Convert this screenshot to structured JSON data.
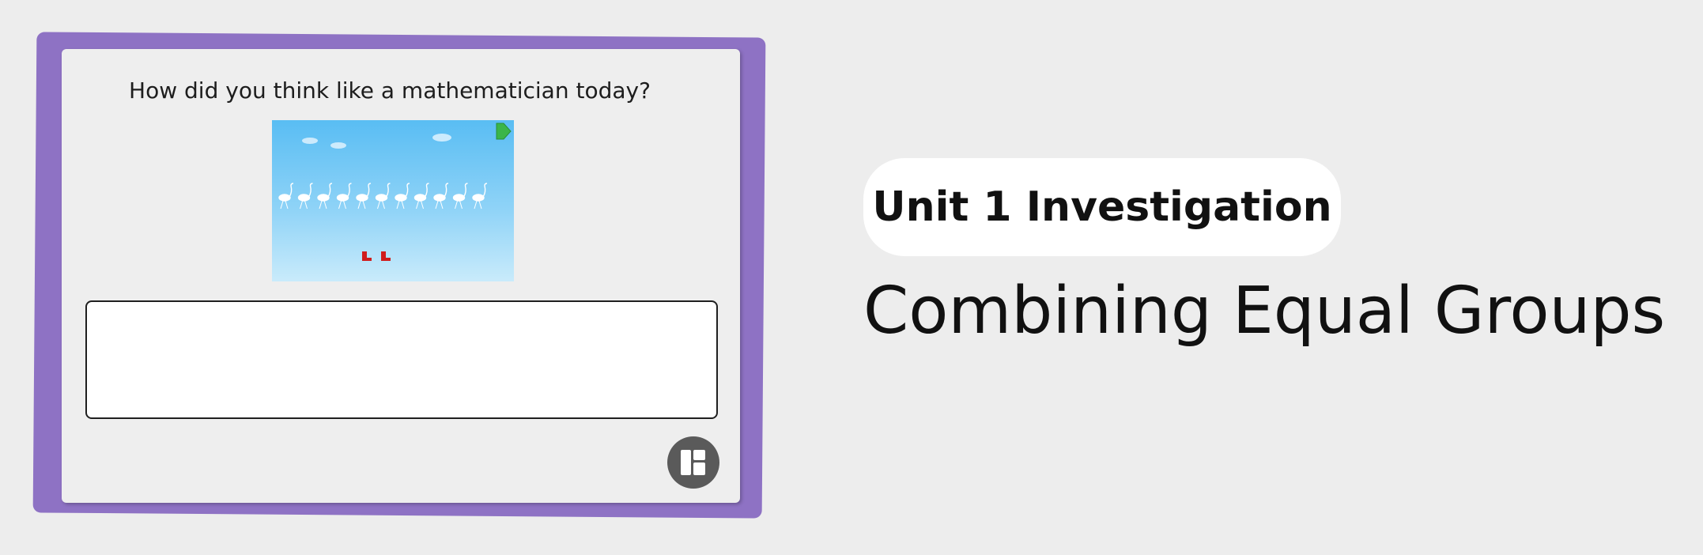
{
  "card": {
    "prompt": "How did you think like a mathematician today?",
    "answer_placeholder": "",
    "colors": {
      "frame": "#8e72c4",
      "card_bg": "#eeeeee",
      "sky_top": "#59bdf3",
      "sky_bottom": "#c9ebfb",
      "play_icon": "#3bb54a",
      "boots": "#d01c1c",
      "layout_button": "#5a5a5a"
    },
    "icons": {
      "play": "play-icon",
      "layout": "layout-grid-icon"
    }
  },
  "unit_label": "Unit 1 Investigation",
  "lesson_title": "Combining Equal Groups"
}
